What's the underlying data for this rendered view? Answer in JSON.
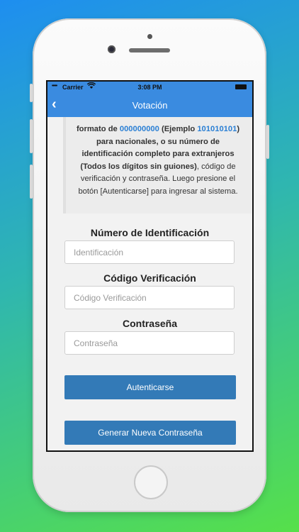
{
  "status_bar": {
    "signal": "•••••",
    "carrier": "Carrier",
    "wifi_icon": "wifi-icon",
    "time": "3:08 PM",
    "battery_icon": "battery-icon"
  },
  "nav": {
    "back_icon": "‹",
    "title": "Votación"
  },
  "instructions": {
    "p1": "formato de ",
    "p2": "000000000",
    "p3": " (Ejemplo ",
    "p4": "101010101",
    "p5": ") para nacionales, o su número de identificación completo para extranjeros (Todos los dígitos sin guiones)",
    "p6": ", código de verificación y contraseña. Luego presione el botón [Autenticarse] para ingresar al sistema."
  },
  "form": {
    "id_label": "Número de Identificación",
    "id_placeholder": "Identificación",
    "code_label": "Código Verificación",
    "code_placeholder": "Código Verificación",
    "password_label": "Contraseña",
    "password_placeholder": "Contraseña",
    "auth_button": "Autenticarse",
    "new_password_button": "Generar Nueva Contraseña"
  },
  "colors": {
    "accent": "#3a8be0",
    "button": "#337ab7",
    "highlight": "#2a7fd4",
    "background_top": "#1e8ef0",
    "background_bottom": "#56e04a"
  }
}
